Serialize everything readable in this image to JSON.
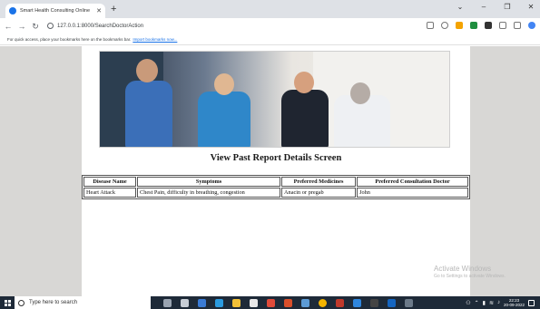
{
  "browser": {
    "tab_title": "Smart Health Consulting Online",
    "url": "127.0.0.1:8000/SearchDoctorAction",
    "bookmarks_text": "For quick access, place your bookmarks here on the bookmarks bar.",
    "bookmarks_link": "Import bookmarks now..."
  },
  "page": {
    "title": "View Past Report Details Screen",
    "table": {
      "headers": [
        "Disease Name",
        "Symptoms",
        "Preferred Medicines",
        "Preferred Consultation Doctor"
      ],
      "rows": [
        [
          "Heart Attack",
          "Chest Pain, difficulty in breathing, congestion",
          "Anacin or pregab",
          "John"
        ]
      ]
    }
  },
  "watermark": {
    "title": "Activate Windows",
    "subtitle": "Go to Settings to activate Windows."
  },
  "taskbar": {
    "search_placeholder": "Type here to search",
    "time": "22:23",
    "date": "20-09-2022"
  },
  "icons": {
    "favicon": "globe-icon",
    "nav": [
      "back-icon",
      "forward-icon",
      "reload-icon"
    ],
    "colors": {
      "ext1": "#f4a300",
      "ext2": "#1e8e3e",
      "ext3": "#333333",
      "ext4": "#4285f4"
    }
  }
}
